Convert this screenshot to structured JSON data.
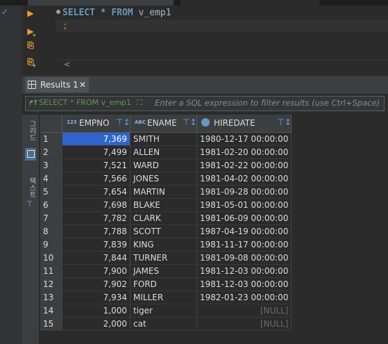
{
  "editor": {
    "line1_keyword1": "SELECT",
    "line1_mid": " * ",
    "line1_keyword2": "FROM",
    "line1_table": " v_emp1",
    "line2": ";",
    "hscroll_left_arrow": "<"
  },
  "results": {
    "tab_label": "Results 1",
    "close_glyph": "✕",
    "filter_query": "SELECT * FROM v_emp1",
    "filter_placeholder": "Enter a SQL expression to filter results (use Ctrl+Space)",
    "side_grid_label": "그리드",
    "side_text_label": "텍스트"
  },
  "columns": [
    {
      "name": "EMPNO",
      "type_badge": "123"
    },
    {
      "name": "ENAME",
      "type_badge": "ABC"
    },
    {
      "name": "HIREDATE",
      "type_badge": ""
    }
  ],
  "rows": [
    {
      "n": "1",
      "empno": "7,369",
      "ename": "SMITH",
      "hiredate": "1980-12-17 00:00:00"
    },
    {
      "n": "2",
      "empno": "7,499",
      "ename": "ALLEN",
      "hiredate": "1981-02-20 00:00:00"
    },
    {
      "n": "3",
      "empno": "7,521",
      "ename": "WARD",
      "hiredate": "1981-02-22 00:00:00"
    },
    {
      "n": "4",
      "empno": "7,566",
      "ename": "JONES",
      "hiredate": "1981-04-02 00:00:00"
    },
    {
      "n": "5",
      "empno": "7,654",
      "ename": "MARTIN",
      "hiredate": "1981-09-28 00:00:00"
    },
    {
      "n": "6",
      "empno": "7,698",
      "ename": "BLAKE",
      "hiredate": "1981-05-01 00:00:00"
    },
    {
      "n": "7",
      "empno": "7,782",
      "ename": "CLARK",
      "hiredate": "1981-06-09 00:00:00"
    },
    {
      "n": "8",
      "empno": "7,788",
      "ename": "SCOTT",
      "hiredate": "1987-04-19 00:00:00"
    },
    {
      "n": "9",
      "empno": "7,839",
      "ename": "KING",
      "hiredate": "1981-11-17 00:00:00"
    },
    {
      "n": "10",
      "empno": "7,844",
      "ename": "TURNER",
      "hiredate": "1981-09-08 00:00:00"
    },
    {
      "n": "11",
      "empno": "7,900",
      "ename": "JAMES",
      "hiredate": "1981-12-03 00:00:00"
    },
    {
      "n": "12",
      "empno": "7,902",
      "ename": "FORD",
      "hiredate": "1981-12-03 00:00:00"
    },
    {
      "n": "13",
      "empno": "7,934",
      "ename": "MILLER",
      "hiredate": "1982-01-23 00:00:00"
    },
    {
      "n": "14",
      "empno": "1,000",
      "ename": "tiger",
      "hiredate": "[NULL]"
    },
    {
      "n": "15",
      "empno": "2,000",
      "ename": "cat",
      "hiredate": "[NULL]"
    }
  ],
  "colors": {
    "background": "#2b2b2b",
    "selection": "#2f65ca",
    "keyword": "#6897bb",
    "filter_query": "#629755"
  }
}
